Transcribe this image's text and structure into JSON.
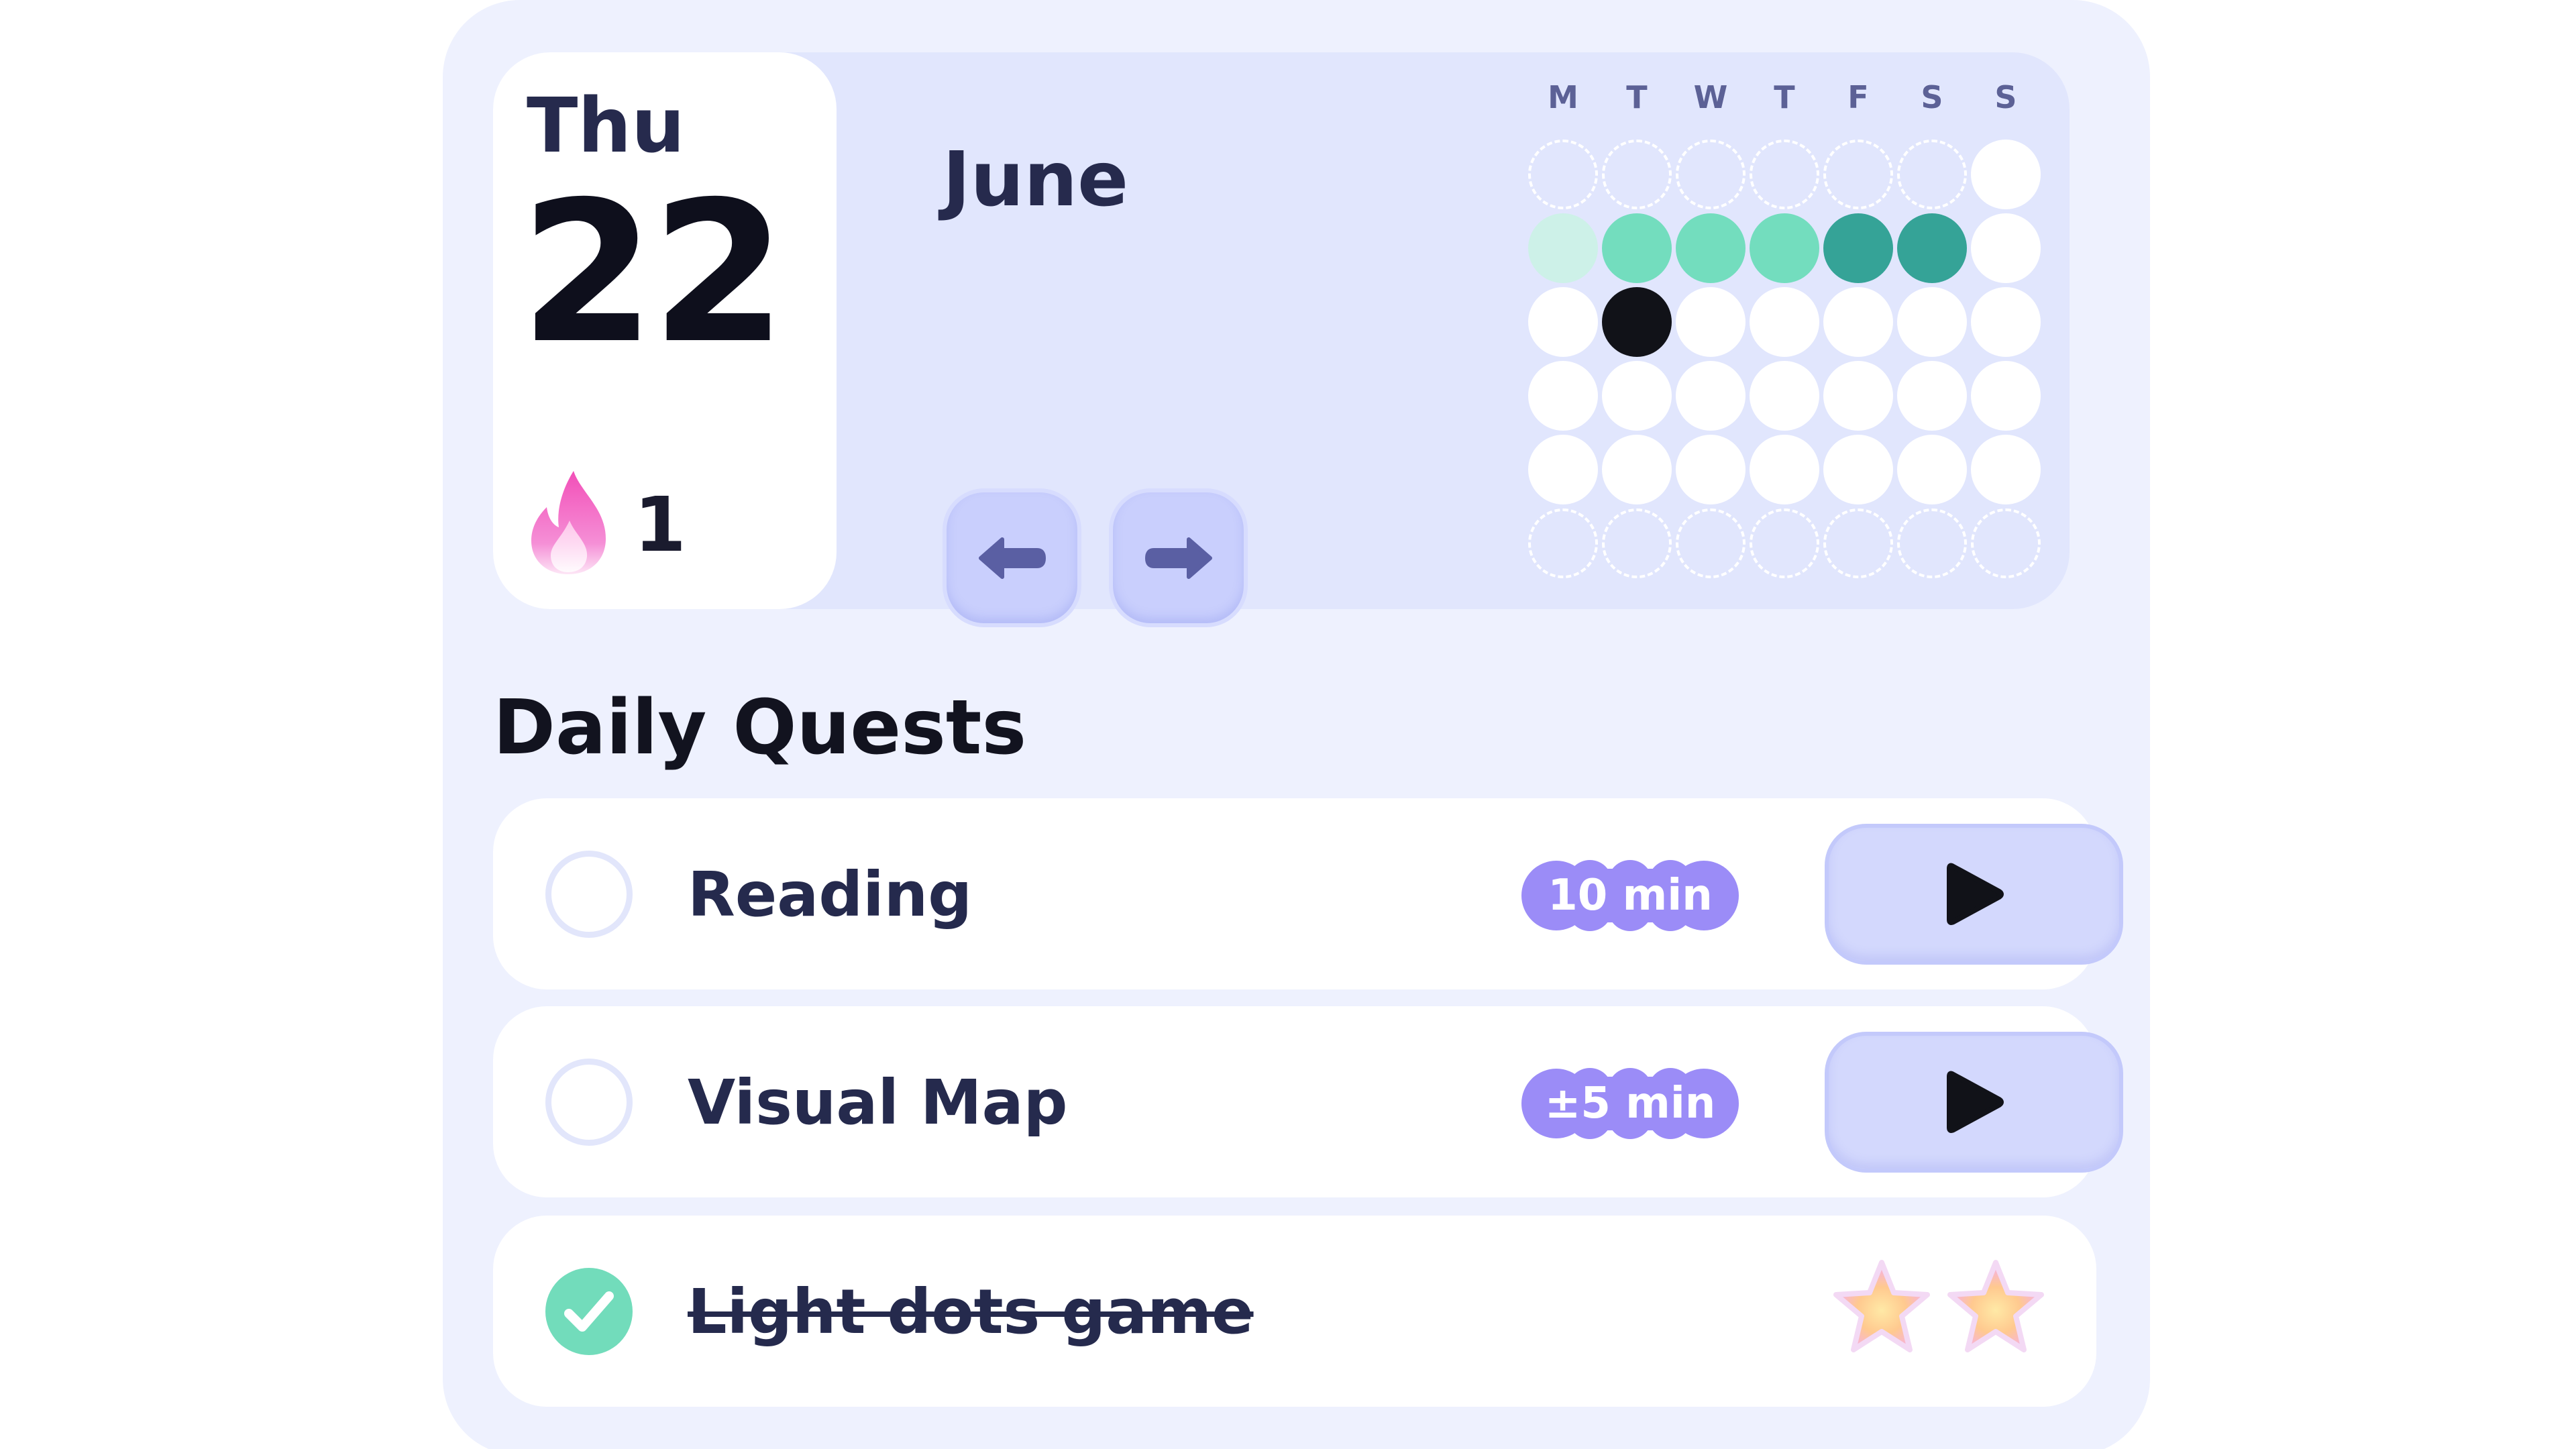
{
  "date_card": {
    "weekday": "Thu",
    "day": "22",
    "streak_count": "1",
    "streak_icon": "flame-icon"
  },
  "calendar": {
    "month": "June",
    "weekdays": [
      "M",
      "T",
      "W",
      "T",
      "F",
      "S",
      "S"
    ],
    "rows": [
      [
        "empty",
        "empty",
        "empty",
        "empty",
        "empty",
        "empty",
        "white"
      ],
      [
        "mint",
        "green",
        "green",
        "green",
        "teal",
        "teal",
        "white"
      ],
      [
        "white",
        "today",
        "white",
        "white",
        "white",
        "white",
        "white"
      ],
      [
        "white",
        "white",
        "white",
        "white",
        "white",
        "white",
        "white"
      ],
      [
        "white",
        "white",
        "white",
        "white",
        "white",
        "white",
        "white"
      ],
      [
        "empty",
        "empty",
        "empty",
        "empty",
        "empty",
        "empty",
        "empty"
      ]
    ],
    "prev_icon": "arrow-left-icon",
    "next_icon": "arrow-right-icon"
  },
  "quests": {
    "title": "Daily Quests",
    "items": [
      {
        "label": "Reading",
        "duration": "10 min",
        "completed": false
      },
      {
        "label": "Visual Map",
        "duration": "±5 min",
        "completed": false
      },
      {
        "label": "Light dots game",
        "completed": true,
        "stars": 2
      }
    ]
  },
  "colors": {
    "card_bg": "#eef1fe",
    "panel_bg": "#e1e6fd",
    "accent_purple": "#9b8cf7",
    "done_green": "#72dcbb",
    "streak_teal": "#35a397",
    "flame_pink": "#f062c6"
  }
}
